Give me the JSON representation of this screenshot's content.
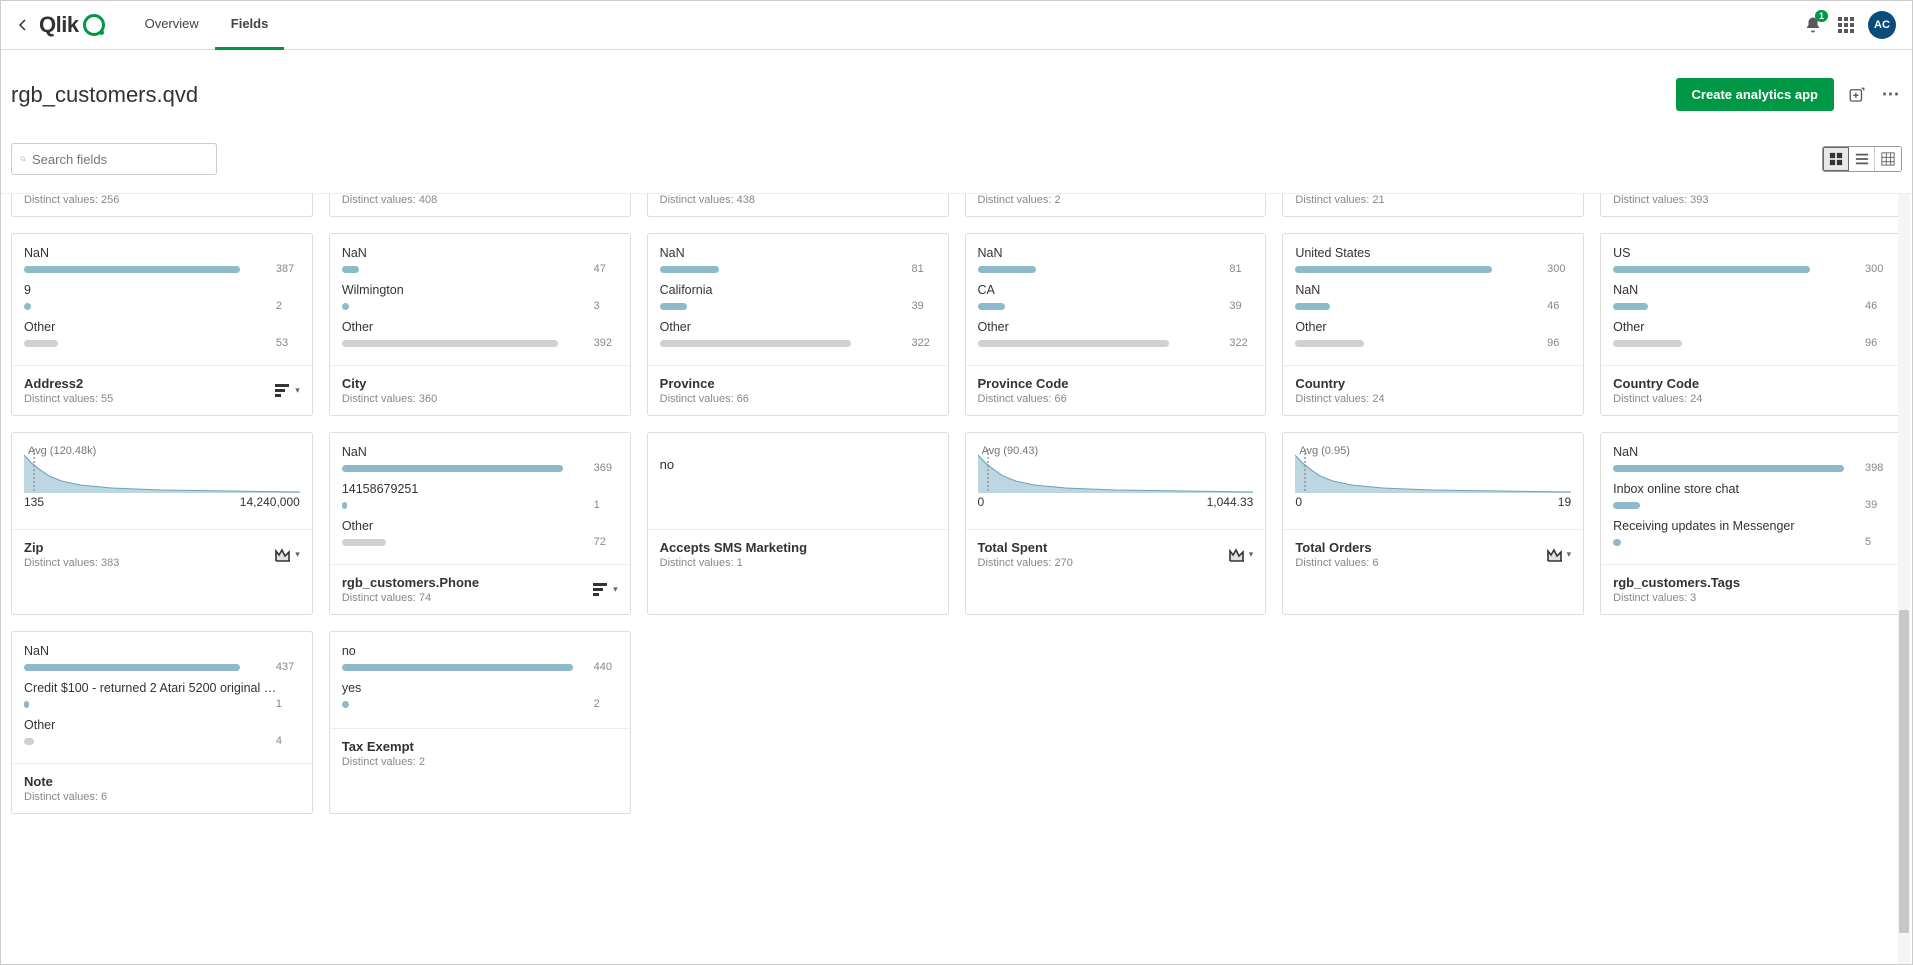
{
  "header": {
    "logo_text": "Qlik",
    "tabs": {
      "overview": "Overview",
      "fields": "Fields"
    },
    "notification_count": "1",
    "avatar_initials": "AC"
  },
  "subheader": {
    "title": "rgb_customers.qvd",
    "create_btn": "Create analytics app"
  },
  "search": {
    "placeholder": "Search fields"
  },
  "top_fragments": [
    {
      "distinct": "Distinct values: 256"
    },
    {
      "distinct": "Distinct values: 408"
    },
    {
      "distinct": "Distinct values: 438"
    },
    {
      "distinct": "Distinct values: 2"
    },
    {
      "distinct": "Distinct values: 21"
    },
    {
      "distinct": "Distinct values: 393"
    }
  ],
  "row1": [
    {
      "name": "Address2",
      "sub": "Distinct values: 55",
      "items": [
        {
          "label": "NaN",
          "val": "387",
          "pct": 88,
          "cls": "blue"
        },
        {
          "label": "9",
          "val": "2",
          "pct": 3,
          "cls": "blue"
        },
        {
          "label": "Other",
          "val": "53",
          "pct": 14,
          "cls": "gray"
        }
      ],
      "icon": "sort"
    },
    {
      "name": "City",
      "sub": "Distinct values: 360",
      "items": [
        {
          "label": "NaN",
          "val": "47",
          "pct": 7,
          "cls": "blue"
        },
        {
          "label": "Wilmington",
          "val": "3",
          "pct": 3,
          "cls": "blue"
        },
        {
          "label": "Other",
          "val": "392",
          "pct": 88,
          "cls": "gray"
        }
      ]
    },
    {
      "name": "Province",
      "sub": "Distinct values: 66",
      "items": [
        {
          "label": "NaN",
          "val": "81",
          "pct": 24,
          "cls": "blue"
        },
        {
          "label": "California",
          "val": "39",
          "pct": 11,
          "cls": "blue"
        },
        {
          "label": "Other",
          "val": "322",
          "pct": 78,
          "cls": "gray"
        }
      ]
    },
    {
      "name": "Province Code",
      "sub": "Distinct values: 66",
      "items": [
        {
          "label": "NaN",
          "val": "81",
          "pct": 24,
          "cls": "blue"
        },
        {
          "label": "CA",
          "val": "39",
          "pct": 11,
          "cls": "blue"
        },
        {
          "label": "Other",
          "val": "322",
          "pct": 78,
          "cls": "gray"
        }
      ]
    },
    {
      "name": "Country",
      "sub": "Distinct values: 24",
      "items": [
        {
          "label": "United States",
          "val": "300",
          "pct": 80,
          "cls": "blue"
        },
        {
          "label": "NaN",
          "val": "46",
          "pct": 14,
          "cls": "blue"
        },
        {
          "label": "Other",
          "val": "96",
          "pct": 28,
          "cls": "gray"
        }
      ]
    },
    {
      "name": "Country Code",
      "sub": "Distinct values: 24",
      "items": [
        {
          "label": "US",
          "val": "300",
          "pct": 80,
          "cls": "blue"
        },
        {
          "label": "NaN",
          "val": "46",
          "pct": 14,
          "cls": "blue"
        },
        {
          "label": "Other",
          "val": "96",
          "pct": 28,
          "cls": "gray"
        }
      ]
    }
  ],
  "row2": [
    {
      "type": "hist",
      "avg": "Avg (120.48k)",
      "min": "135",
      "max": "14,240,000",
      "name": "Zip",
      "sub": "Distinct values: 383",
      "icon": "chart"
    },
    {
      "type": "dist",
      "items": [
        {
          "label": "NaN",
          "val": "369",
          "pct": 90,
          "cls": "blue"
        },
        {
          "label": "14158679251",
          "val": "1",
          "pct": 2,
          "cls": "blue"
        },
        {
          "label": "Other",
          "val": "72",
          "pct": 18,
          "cls": "gray"
        }
      ],
      "name": "rgb_customers.Phone",
      "sub": "Distinct values: 74",
      "icon": "sort"
    },
    {
      "type": "single",
      "value": "no",
      "name": "Accepts SMS Marketing",
      "sub": "Distinct values: 1"
    },
    {
      "type": "hist",
      "avg": "Avg (90.43)",
      "min": "0",
      "max": "1,044.33",
      "name": "Total Spent",
      "sub": "Distinct values: 270",
      "icon": "chart"
    },
    {
      "type": "hist",
      "avg": "Avg (0.95)",
      "min": "0",
      "max": "19",
      "name": "Total Orders",
      "sub": "Distinct values: 6",
      "icon": "chart"
    },
    {
      "type": "dist",
      "items": [
        {
          "label": "NaN",
          "val": "398",
          "pct": 94,
          "cls": "blue"
        },
        {
          "label": "Inbox online store chat",
          "val": "39",
          "pct": 11,
          "cls": "blue"
        },
        {
          "label": "Receiving updates in Messenger",
          "val": "5",
          "pct": 3,
          "cls": "blue"
        }
      ],
      "name": "rgb_customers.Tags",
      "sub": "Distinct values: 3"
    }
  ],
  "row3": [
    {
      "type": "dist",
      "items": [
        {
          "label": "NaN",
          "val": "437",
          "pct": 88,
          "cls": "blue"
        },
        {
          "label": "Credit $100 - returned 2 Atari 5200 original …",
          "val": "1",
          "pct": 2,
          "cls": "blue"
        },
        {
          "label": "Other",
          "val": "4",
          "pct": 4,
          "cls": "gray"
        }
      ],
      "name": "Note",
      "sub": "Distinct values: 6"
    },
    {
      "type": "dist",
      "items": [
        {
          "label": "no",
          "val": "440",
          "pct": 94,
          "cls": "blue"
        },
        {
          "label": "yes",
          "val": "2",
          "pct": 3,
          "cls": "blue"
        }
      ],
      "name": "Tax Exempt",
      "sub": "Distinct values: 2"
    }
  ]
}
